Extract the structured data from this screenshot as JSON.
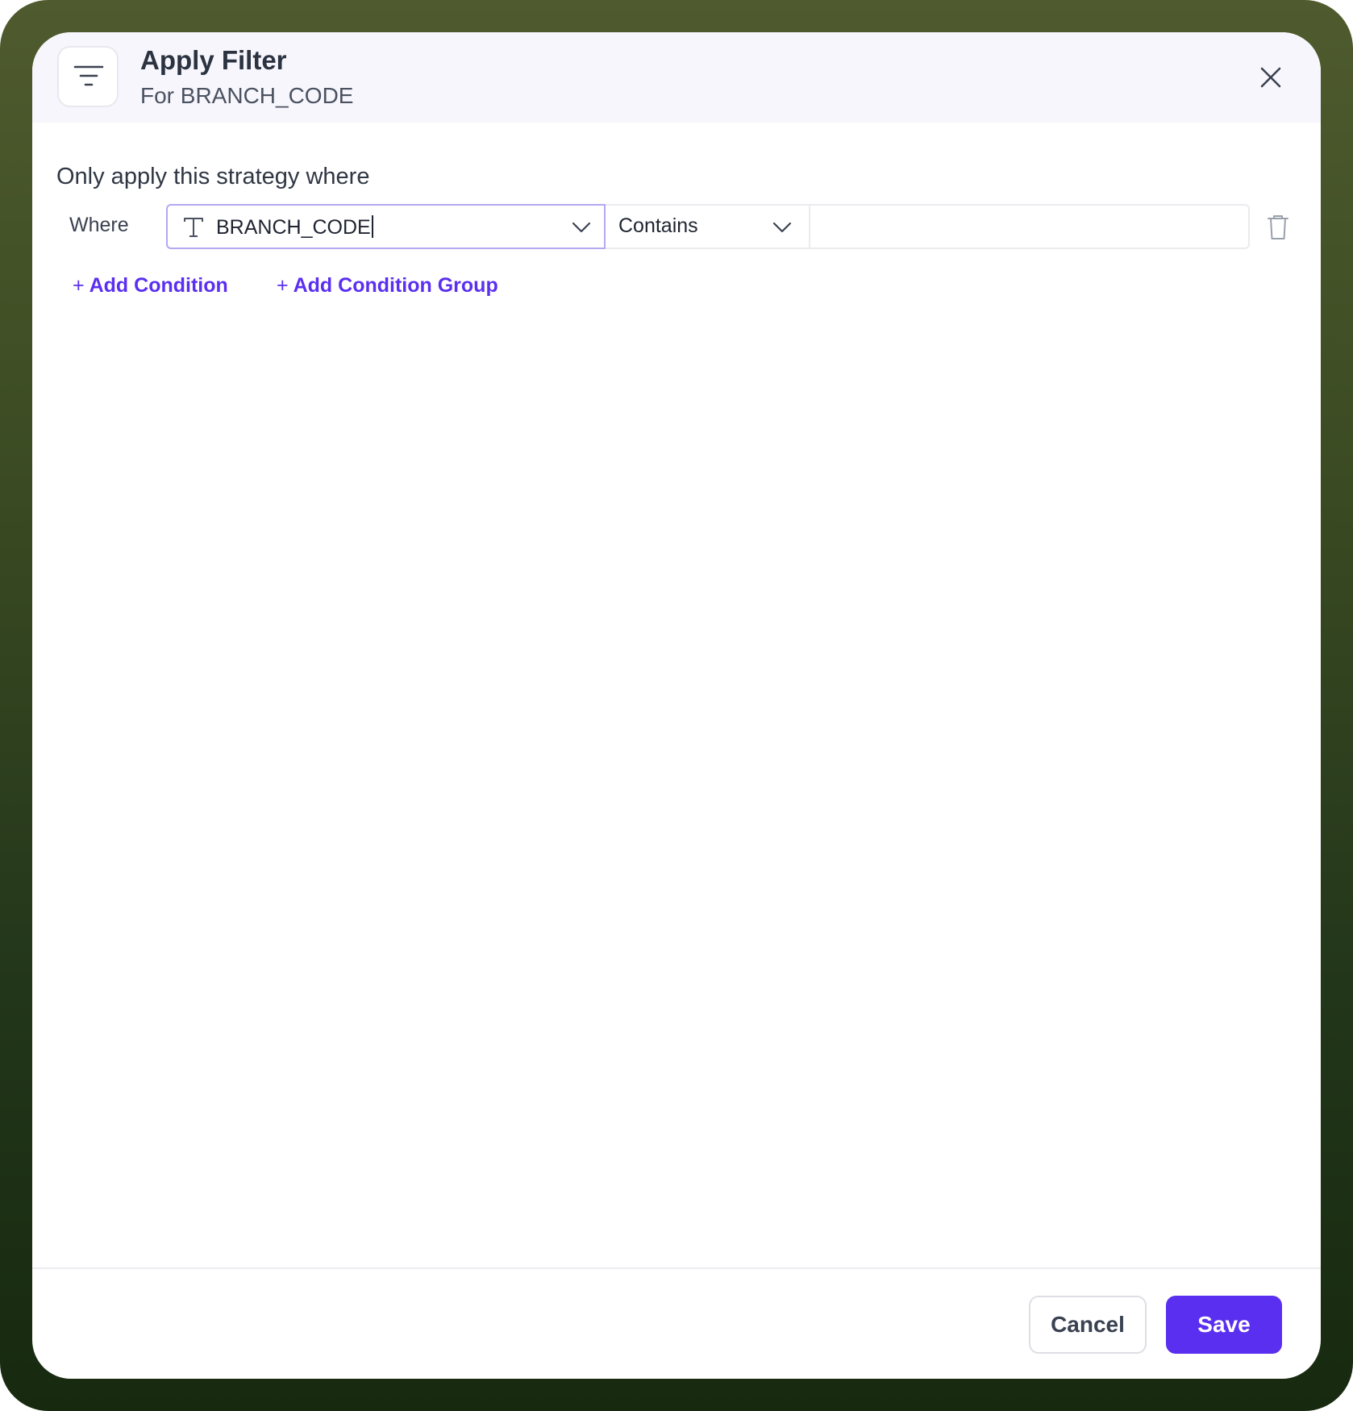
{
  "header": {
    "title": "Apply Filter",
    "subtitle": "For BRANCH_CODE",
    "icon": "filter-lines-icon",
    "close_icon": "close-icon"
  },
  "body": {
    "section_label": "Only apply this strategy where",
    "condition": {
      "prefix": "Where",
      "field": {
        "type_icon": "text-type-icon",
        "value": "BRANCH_CODE"
      },
      "operator": {
        "value": "Contains"
      },
      "value_input": {
        "value": ""
      },
      "delete_icon": "trash-icon"
    },
    "actions": {
      "add_condition": "Add Condition",
      "add_condition_group": "Add Condition Group"
    }
  },
  "footer": {
    "cancel_label": "Cancel",
    "save_label": "Save"
  },
  "colors": {
    "accent": "#5b2ff0",
    "field_focus_border": "#b4a8f3",
    "header_bg": "#f7f6fc",
    "frame_top": "#4f5b2e",
    "frame_bottom": "#172a10"
  }
}
